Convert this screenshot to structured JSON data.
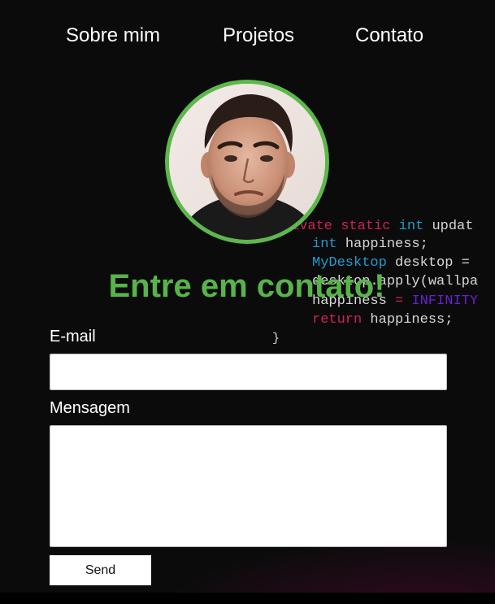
{
  "nav": {
    "items": [
      {
        "label": "Sobre mim"
      },
      {
        "label": "Projetos"
      },
      {
        "label": "Contato"
      }
    ]
  },
  "code": {
    "line1": {
      "kw1": "ivate",
      "kw2": "static",
      "kw3": "int",
      "rest": "updat"
    },
    "line2": {
      "kw": "int",
      "rest": "happiness;"
    },
    "line3": {
      "kw": "MyDesktop",
      "rest": "desktop ="
    },
    "line4": {
      "rest": "desktop.apply(wallpa"
    },
    "line5": {
      "plain": "happiness",
      "op": "=",
      "kw": "INFINITY"
    },
    "line6": {
      "kw": "return",
      "rest": "happiness;"
    },
    "line7": {
      "rest": "}"
    }
  },
  "profile": {
    "avatar_alt": "",
    "border_color": "#5cb84a"
  },
  "contact": {
    "title": "Entre em contato!",
    "email_label": "E-mail",
    "email_value": "",
    "message_label": "Mensagem",
    "message_value": "",
    "send_label": "Send"
  },
  "colors": {
    "accent": "#58b44a",
    "code_keyword_red": "#d21f5a",
    "code_keyword_blue": "#1d9fd0",
    "code_keyword_purple": "#6a1fd6",
    "background": "#0b0b0b"
  }
}
